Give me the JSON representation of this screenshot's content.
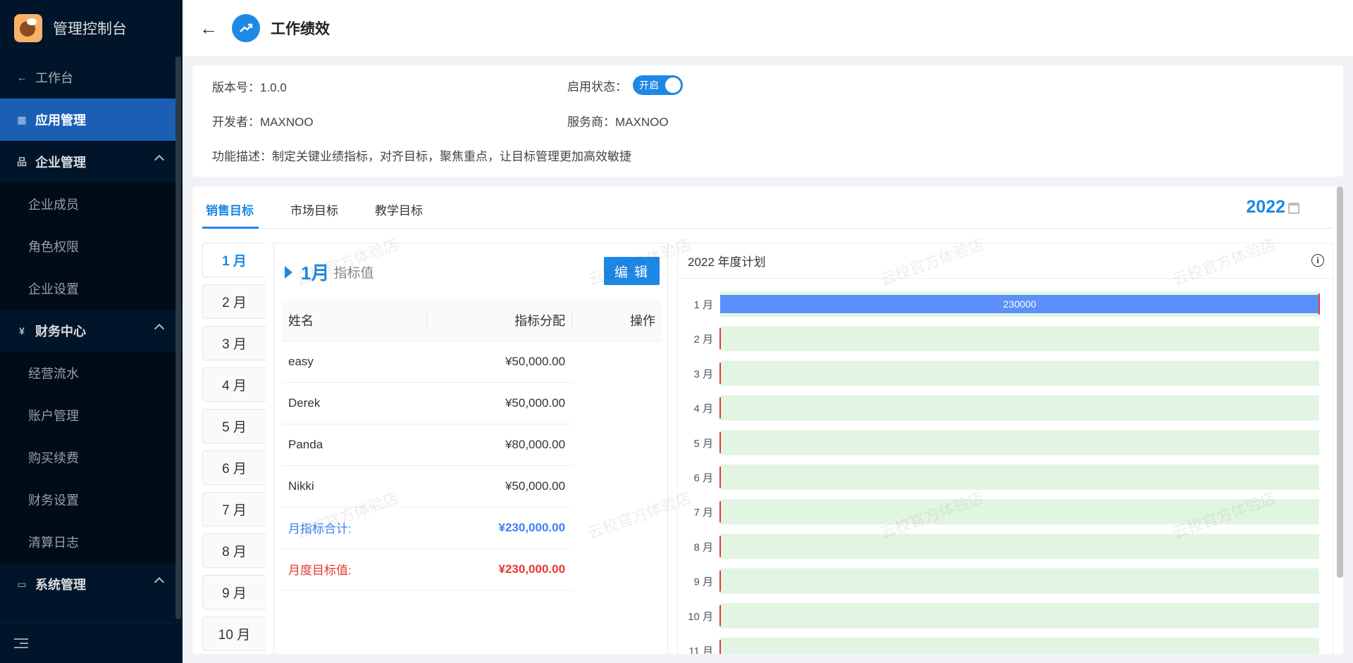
{
  "sidebar": {
    "brand": "管理控制台",
    "items": [
      {
        "label": "工作台",
        "type": "back"
      },
      {
        "label": "应用管理",
        "type": "active"
      },
      {
        "label": "企业管理",
        "type": "group"
      },
      {
        "label": "企业成员",
        "type": "sub"
      },
      {
        "label": "角色权限",
        "type": "sub"
      },
      {
        "label": "企业设置",
        "type": "sub"
      },
      {
        "label": "财务中心",
        "type": "group"
      },
      {
        "label": "经营流水",
        "type": "sub"
      },
      {
        "label": "账户管理",
        "type": "sub"
      },
      {
        "label": "购买续费",
        "type": "sub"
      },
      {
        "label": "财务设置",
        "type": "sub"
      },
      {
        "label": "清算日志",
        "type": "sub"
      },
      {
        "label": "系统管理",
        "type": "group"
      }
    ]
  },
  "header": {
    "title": "工作绩效"
  },
  "info": {
    "version": "版本号：1.0.0",
    "status_label": "启用状态：",
    "toggle_label": "开启",
    "developer": "开发者：MAXNOO",
    "provider": "服务商：MAXNOO",
    "description": "功能描述：制定关键业绩指标，对齐目标，聚焦重点，让目标管理更加高效敏捷"
  },
  "tabs": [
    "销售目标",
    "市场目标",
    "教学目标"
  ],
  "year": "2022",
  "months": [
    "1 月",
    "2 月",
    "3 月",
    "4 月",
    "5 月",
    "6 月",
    "7 月",
    "8 月",
    "9 月",
    "10 月"
  ],
  "panel": {
    "month_title": "1月",
    "subtitle": "指标值",
    "edit_label": "编 辑",
    "columns": [
      "姓名",
      "指标分配",
      "操作"
    ],
    "rows": [
      {
        "name": "easy",
        "amount": "¥50,000.00"
      },
      {
        "name": "Derek",
        "amount": "¥50,000.00"
      },
      {
        "name": "Panda",
        "amount": "¥80,000.00"
      },
      {
        "name": "Nikki",
        "amount": "¥50,000.00"
      }
    ],
    "sum_label": "月指标合计:",
    "sum_value": "¥230,000.00",
    "target_label": "月度目标值:",
    "target_value": "¥230,000.00"
  },
  "watermark": "云校官方体验店",
  "chart_data": {
    "type": "bar",
    "orientation": "horizontal",
    "title": "2022 年度计划",
    "categories": [
      "1 月",
      "2 月",
      "3 月",
      "4 月",
      "5 月",
      "6 月",
      "7 月",
      "8 月",
      "9 月",
      "10 月",
      "11 月"
    ],
    "values": [
      230000,
      0,
      0,
      0,
      0,
      0,
      0,
      0,
      0,
      0,
      0
    ],
    "targets": [
      230000,
      null,
      null,
      null,
      null,
      null,
      null,
      null,
      null,
      null,
      null
    ],
    "data_labels": [
      "230000",
      "",
      "",
      "",
      "",
      "",
      "",
      "",
      "",
      "",
      ""
    ],
    "colors": {
      "bar": "#5b8ff9",
      "track": "#e2f5e2",
      "target": "#e53935"
    }
  }
}
